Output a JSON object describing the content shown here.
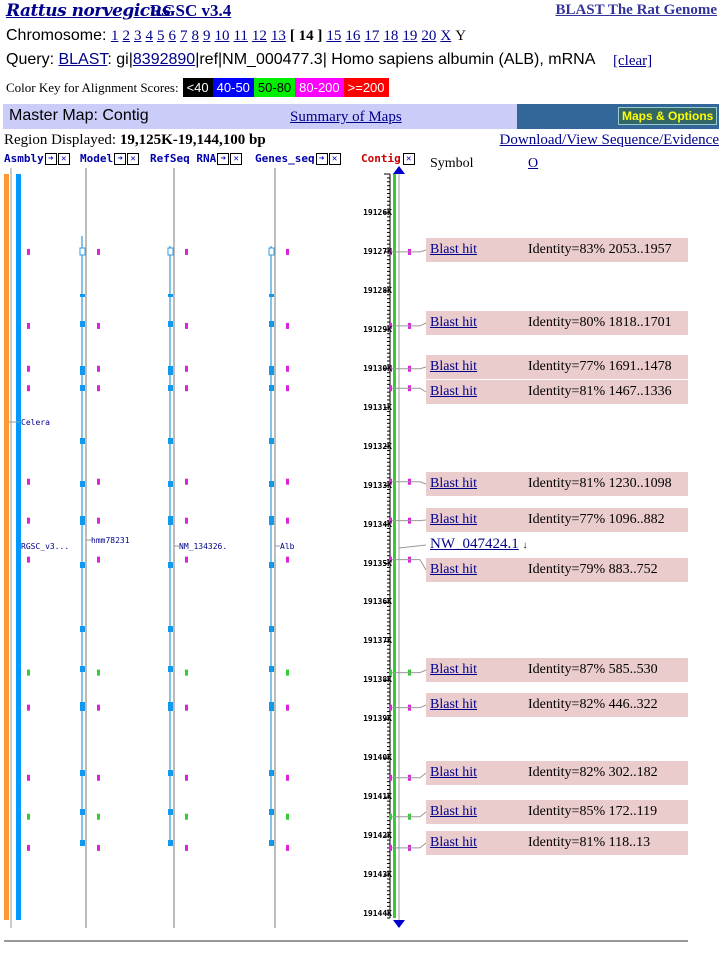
{
  "header": {
    "species": "Rattus norvegicus",
    "assembly": "RGSC v3.4",
    "blast_link": "BLAST The Rat Genome"
  },
  "chromosome": {
    "label": "Chromosome:",
    "items": [
      "1",
      "2",
      "3",
      "4",
      "5",
      "6",
      "7",
      "8",
      "9",
      "10",
      "11",
      "12",
      "13",
      "[ 14 ]",
      "15",
      "16",
      "17",
      "18",
      "19",
      "20",
      "X",
      "Y"
    ],
    "current": "[ 14 ]"
  },
  "query": {
    "label": "Query:",
    "blast": "BLAST",
    "sep1": ": gi|",
    "gi": "8392890",
    "rest": "|ref|NM_000477.3| Homo sapiens albumin (ALB), mRNA",
    "clear": "[clear]"
  },
  "color_key": {
    "label": "Color Key for Alignment Scores:",
    "items": [
      {
        "text": "<40",
        "bg": "#000000",
        "fg": "#ffffff"
      },
      {
        "text": "40-50",
        "bg": "#0000ff",
        "fg": "#ffffff"
      },
      {
        "text": "50-80",
        "bg": "#00ee00",
        "fg": "#000000"
      },
      {
        "text": "80-200",
        "bg": "#ff00ff",
        "fg": "#ffffff"
      },
      {
        "text": ">=200",
        "bg": "#ff0000",
        "fg": "#ffffff"
      }
    ]
  },
  "master_map": {
    "title": "Master Map: Contig",
    "summary_link": "Summary of Maps",
    "options_button": "Maps & Options"
  },
  "region": {
    "label": "Region Displayed:",
    "value": "19,125K-19,144,100 bp",
    "download_link": "Download/View Sequence/Evidence"
  },
  "tracks": [
    {
      "name": "Asmbly",
      "labels": [
        "Celera",
        "RGSC_v3..."
      ]
    },
    {
      "name": "Model",
      "labels": [
        "hmm78231"
      ]
    },
    {
      "name": "RefSeq RNA",
      "labels": [
        "NM_134326."
      ]
    },
    {
      "name": "Genes_seq",
      "labels": [
        "Alb"
      ]
    }
  ],
  "contig": {
    "name": "Contig",
    "symbol_header": "Symbol",
    "o_link": "O",
    "ruler_start_k": 19125,
    "ruler_end_k": 19144.1,
    "tick_labels": [
      "19126K",
      "19127K",
      "19128K",
      "19129K",
      "19130K",
      "19131K",
      "19132K",
      "19133K",
      "19134K",
      "19135K",
      "19136K",
      "19137K",
      "19138K",
      "19139K",
      "19140K",
      "19141K",
      "19142K",
      "19143K",
      "19144K"
    ],
    "contig_label": "NW_047424.1",
    "contig_pos_k": 19134.6
  },
  "hits": [
    {
      "link": "Blast hit",
      "identity": "Identity=83% 2053..1957",
      "pos_k": 19127.0,
      "color": "magenta"
    },
    {
      "link": "Blast hit",
      "identity": "Identity=80% 1818..1701",
      "pos_k": 19128.9,
      "color": "magenta"
    },
    {
      "link": "Blast hit",
      "identity": "Identity=77% 1691..1478",
      "pos_k": 19130.0,
      "color": "magenta"
    },
    {
      "link": "Blast hit",
      "identity": "Identity=81% 1467..1336",
      "pos_k": 19130.5,
      "color": "magenta"
    },
    {
      "link": "Blast hit",
      "identity": "Identity=81% 1230..1098",
      "pos_k": 19132.9,
      "color": "magenta"
    },
    {
      "link": "Blast hit",
      "identity": "Identity=77% 1096..882",
      "pos_k": 19133.9,
      "color": "magenta"
    },
    {
      "link": "Blast hit",
      "identity": "Identity=79% 883..752",
      "pos_k": 19134.9,
      "color": "magenta"
    },
    {
      "link": "Blast hit",
      "identity": "Identity=87% 585..530",
      "pos_k": 19137.8,
      "color": "green"
    },
    {
      "link": "Blast hit",
      "identity": "Identity=82% 446..322",
      "pos_k": 19138.7,
      "color": "magenta"
    },
    {
      "link": "Blast hit",
      "identity": "Identity=82% 302..182",
      "pos_k": 19140.5,
      "color": "magenta"
    },
    {
      "link": "Blast hit",
      "identity": "Identity=85% 172..119",
      "pos_k": 19141.5,
      "color": "green"
    },
    {
      "link": "Blast hit",
      "identity": "Identity=81% 118..13",
      "pos_k": 19142.3,
      "color": "magenta"
    }
  ]
}
